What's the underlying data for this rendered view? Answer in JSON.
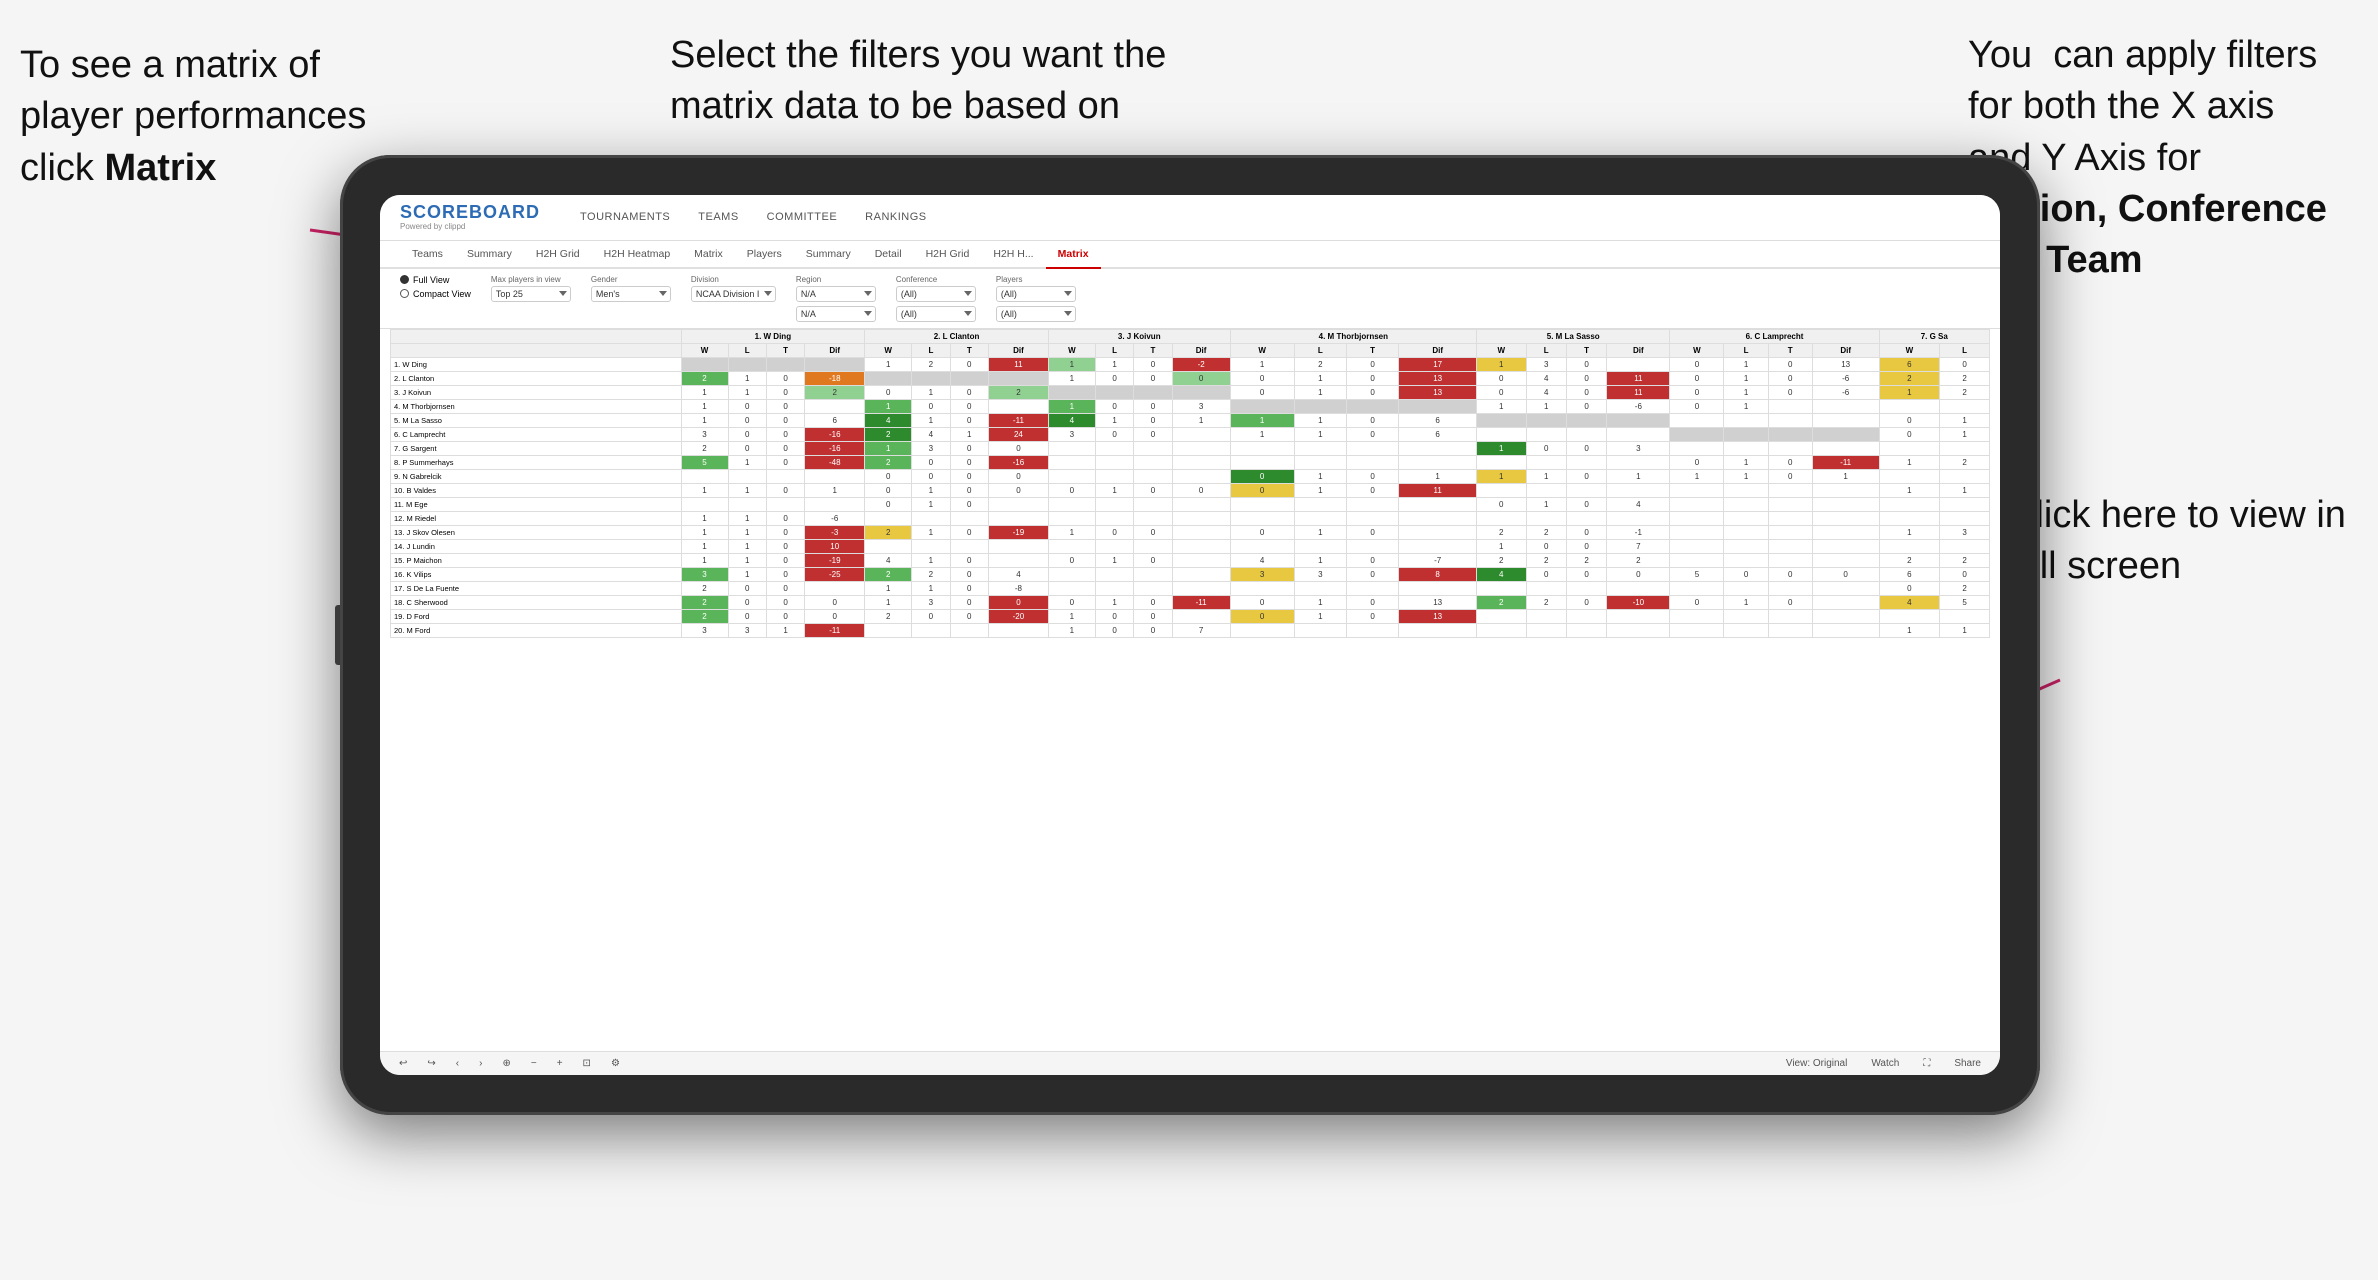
{
  "annotations": {
    "topleft": {
      "line1": "To see a matrix of",
      "line2": "player performances",
      "line3_prefix": "click ",
      "line3_bold": "Matrix"
    },
    "topmid": {
      "text": "Select the filters you want the matrix data to be based on"
    },
    "topright": {
      "line1": "You  can apply",
      "line2": "filters for both",
      "line3": "the X axis and Y",
      "line4_prefix": "Axis for ",
      "line4_bold": "Region,",
      "line5_bold": "Conference and",
      "line6_bold": "Team"
    },
    "bottomright": {
      "line1": "Click here to view",
      "line2": "in full screen"
    }
  },
  "app": {
    "logo": "SCOREBOARD",
    "logo_sub": "Powered by clippd",
    "nav_items": [
      "TOURNAMENTS",
      "TEAMS",
      "COMMITTEE",
      "RANKINGS"
    ]
  },
  "sub_tabs": [
    {
      "label": "Teams",
      "active": false
    },
    {
      "label": "Summary",
      "active": false
    },
    {
      "label": "H2H Grid",
      "active": false
    },
    {
      "label": "H2H Heatmap",
      "active": false
    },
    {
      "label": "Matrix",
      "active": false
    },
    {
      "label": "Players",
      "active": false
    },
    {
      "label": "Summary",
      "active": false
    },
    {
      "label": "Detail",
      "active": false
    },
    {
      "label": "H2H Grid",
      "active": false
    },
    {
      "label": "H2H H...",
      "active": false
    },
    {
      "label": "Matrix",
      "active": true
    }
  ],
  "filters": {
    "view_options": [
      "Full View",
      "Compact View"
    ],
    "selected_view": "Full View",
    "max_players_label": "Max players in view",
    "max_players_value": "Top 25",
    "gender_label": "Gender",
    "gender_value": "Men's",
    "division_label": "Division",
    "division_value": "NCAA Division I",
    "region_label": "Region",
    "region_values": [
      "N/A",
      "N/A"
    ],
    "conference_label": "Conference",
    "conference_values": [
      "(All)",
      "(All)"
    ],
    "players_label": "Players",
    "players_values": [
      "(All)",
      "(All)"
    ]
  },
  "column_headers": [
    "1. W Ding",
    "2. L Clanton",
    "3. J Koivun",
    "4. M Thorbjornsen",
    "5. M La Sasso",
    "6. C Lamprecht",
    "7. G Sa"
  ],
  "sub_col_headers": [
    "W",
    "L",
    "T",
    "Dif"
  ],
  "rows": [
    {
      "name": "1. W Ding",
      "cells": [
        [],
        [],
        [],
        [],
        [],
        [],
        []
      ]
    },
    {
      "name": "2. L Clanton",
      "cells": []
    },
    {
      "name": "3. J Koivun",
      "cells": []
    },
    {
      "name": "4. M Thorbjornsen",
      "cells": []
    },
    {
      "name": "5. M La Sasso",
      "cells": []
    },
    {
      "name": "6. C Lamprecht",
      "cells": []
    },
    {
      "name": "7. G Sargent",
      "cells": []
    },
    {
      "name": "8. P Summerhays",
      "cells": []
    },
    {
      "name": "9. N Gabrelcik",
      "cells": []
    },
    {
      "name": "10. B Valdes",
      "cells": []
    },
    {
      "name": "11. M Ege",
      "cells": []
    },
    {
      "name": "12. M Riedel",
      "cells": []
    },
    {
      "name": "13. J Skov Olesen",
      "cells": []
    },
    {
      "name": "14. J Lundin",
      "cells": []
    },
    {
      "name": "15. P Maichon",
      "cells": []
    },
    {
      "name": "16. K Vilips",
      "cells": []
    },
    {
      "name": "17. S De La Fuente",
      "cells": []
    },
    {
      "name": "18. C Sherwood",
      "cells": []
    },
    {
      "name": "19. D Ford",
      "cells": []
    },
    {
      "name": "20. M Ford",
      "cells": []
    }
  ],
  "toolbar": {
    "view_label": "View: Original",
    "watch_label": "Watch",
    "share_label": "Share"
  }
}
